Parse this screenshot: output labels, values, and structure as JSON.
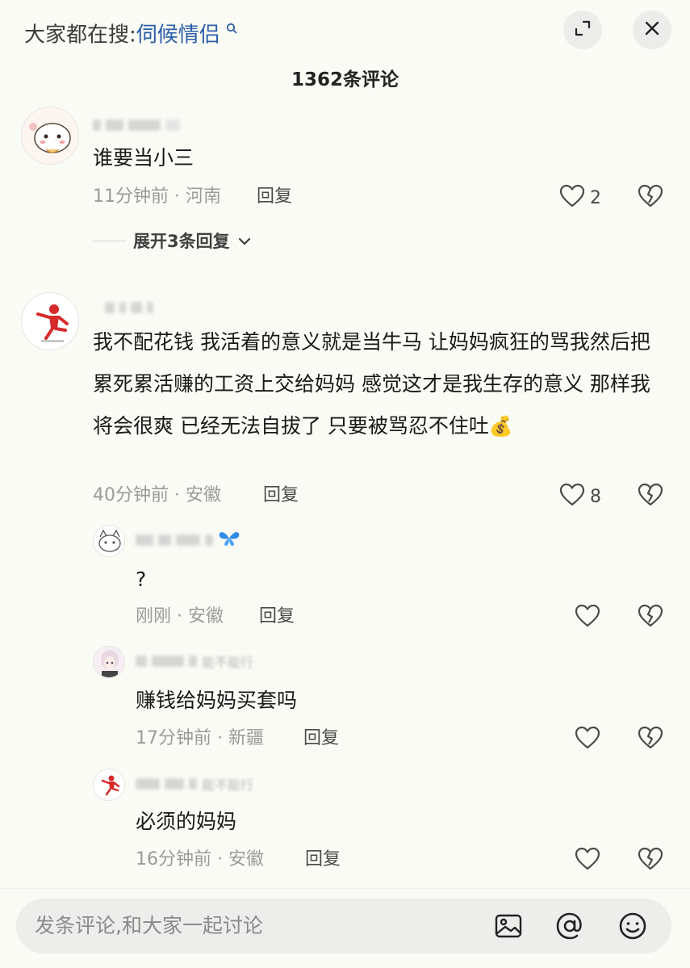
{
  "header": {
    "search_prefix": "大家都在搜:",
    "search_term": "伺候情侣",
    "comment_count_title": "1362条评论"
  },
  "comments": [
    {
      "nickname": "",
      "text": "谁要当小三",
      "time_location": "11分钟前 · 河南",
      "reply_label": "回复",
      "likes": "2",
      "expand_label": "展开3条回复"
    },
    {
      "nickname": "",
      "text": "我不配花钱 我活着的意义就是当牛马 让妈妈疯狂的骂我然后把累死累活赚的工资上交给妈妈 感觉这才是我生存的意义 那样我将会很爽 已经无法自拔了 只要被骂忍不住吐",
      "emoji": "💰",
      "time_location": "40分钟前 · 安徽",
      "reply_label": "回复",
      "likes": "8",
      "replies": [
        {
          "text": "?",
          "time_location": "刚刚 · 安徽",
          "reply_label": "回复"
        },
        {
          "nickname_fragment": "能不能行",
          "text": "赚钱给妈妈买套吗",
          "time_location": "17分钟前 · 新疆",
          "reply_label": "回复"
        },
        {
          "nickname_fragment": "能不能行",
          "text": "必须的妈妈",
          "time_location": "16分钟前 · 安徽",
          "reply_label": "回复"
        }
      ]
    }
  ],
  "composer": {
    "placeholder": "发条评论,和大家一起讨论",
    "icons": [
      "image-icon",
      "at-icon",
      "emoji-icon"
    ]
  },
  "colors": {
    "background": "#fbfbf5",
    "search_term": "#2a5ea8",
    "meta_text": "#9a9a9a"
  }
}
